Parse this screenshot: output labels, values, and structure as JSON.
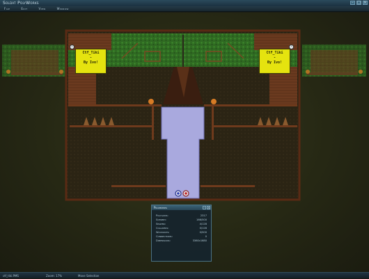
{
  "window": {
    "title": "Soldat PolyWorks",
    "buttons": {
      "minimize": "–",
      "maximize": "□",
      "close": "×"
    }
  },
  "menu": {
    "items": [
      "File",
      "Edit",
      "View",
      "Window"
    ]
  },
  "map": {
    "sign_left": {
      "line1": "Ctf_Tiki",
      "line2": "-",
      "line3": "By Ivo!"
    },
    "sign_right": {
      "line1": "Ctf_Tiki",
      "line2": "-",
      "line3": "By Ivo!"
    }
  },
  "properties": {
    "title": "Properties",
    "rows": [
      {
        "key": "Polygons:",
        "value": "2317"
      },
      {
        "key": "Scenery:",
        "value": "166/500"
      },
      {
        "key": "Spawns:",
        "value": "4/128"
      },
      {
        "key": "Colliders:",
        "value": "0/128"
      },
      {
        "key": "Waypoints:",
        "value": "0/500"
      },
      {
        "key": "Connections:",
        "value": "0"
      },
      {
        "key": "Dimensions:",
        "value": "3360x1680"
      }
    ]
  },
  "status": {
    "file": "ctf_tiki.PMS",
    "zoom": "Zoom: 17%",
    "tool": "Move Selection"
  }
}
